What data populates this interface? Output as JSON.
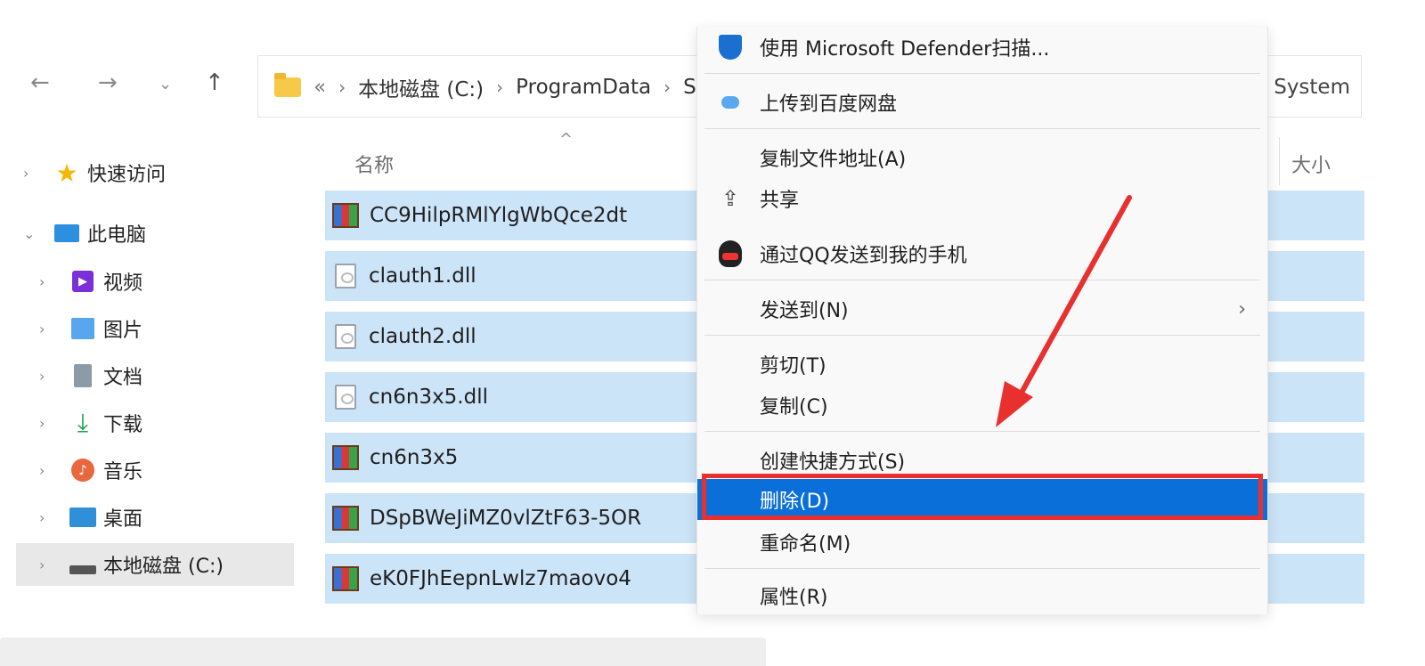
{
  "nav": {
    "back_icon": "arrow-left-icon",
    "forward_icon": "arrow-right-icon",
    "recent_icon": "chevron-down-icon",
    "up_icon": "arrow-up-icon"
  },
  "address": {
    "overflow": "«",
    "crumbs": [
      "本地磁盘 (C:)",
      "ProgramData",
      "S"
    ],
    "right_text": "System"
  },
  "sidebar": {
    "items": [
      {
        "label": "快速访问",
        "icon": "star-icon"
      },
      {
        "label": "此电脑",
        "icon": "computer-icon"
      },
      {
        "label": "视频",
        "icon": "video-icon"
      },
      {
        "label": "图片",
        "icon": "pictures-icon"
      },
      {
        "label": "文档",
        "icon": "documents-icon"
      },
      {
        "label": "下载",
        "icon": "download-icon"
      },
      {
        "label": "音乐",
        "icon": "music-icon"
      },
      {
        "label": "桌面",
        "icon": "desktop-icon"
      },
      {
        "label": "本地磁盘 (C:)",
        "icon": "drive-icon"
      }
    ]
  },
  "file_list": {
    "col_name": "名称",
    "col_size": "大小",
    "files": [
      {
        "name": "CC9HilpRMlYlgWbQce2dt",
        "type": "rar"
      },
      {
        "name": "clauth1.dll",
        "type": "dll"
      },
      {
        "name": "clauth2.dll",
        "type": "dll"
      },
      {
        "name": "cn6n3x5.dll",
        "type": "dll"
      },
      {
        "name": "cn6n3x5",
        "type": "rar"
      },
      {
        "name": "DSpBWeJiMZ0vlZtF63-5OR",
        "type": "rar"
      },
      {
        "name": "eK0FJhEepnLwlz7maovo4",
        "type": "rar"
      }
    ]
  },
  "context_menu": {
    "items": [
      {
        "label": "使用 Microsoft Defender扫描...",
        "icon": "defender-shield-icon"
      },
      {
        "label": "上传到百度网盘",
        "icon": "baidu-cloud-icon"
      },
      {
        "label": "复制文件地址(A)",
        "icon": ""
      },
      {
        "label": "共享",
        "icon": "share-icon"
      },
      {
        "label": "通过QQ发送到我的手机",
        "icon": "qq-icon"
      },
      {
        "label": "发送到(N)",
        "icon": "",
        "submenu": "›"
      },
      {
        "label": "剪切(T)",
        "icon": ""
      },
      {
        "label": "复制(C)",
        "icon": ""
      },
      {
        "label": "创建快捷方式(S)",
        "icon": ""
      },
      {
        "label": "删除(D)",
        "icon": "",
        "highlighted": true
      },
      {
        "label": "重命名(M)",
        "icon": ""
      },
      {
        "label": "属性(R)",
        "icon": ""
      }
    ]
  },
  "colors": {
    "selection": "#cce4f7",
    "menu_highlight": "#0a6fd9",
    "annotation_red": "#e8302f"
  }
}
